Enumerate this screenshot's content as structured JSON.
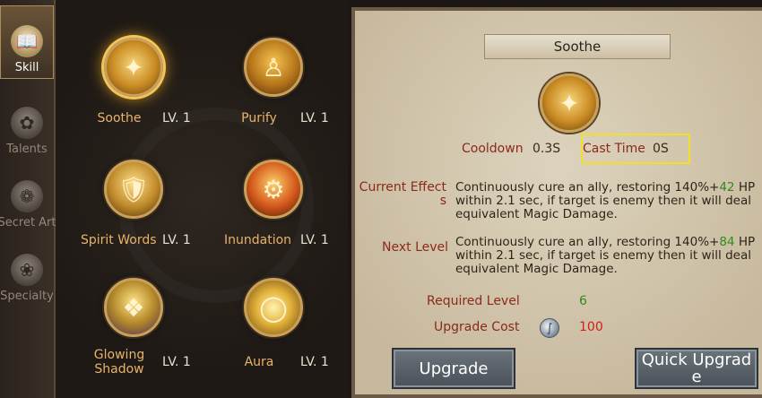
{
  "nav": {
    "items": [
      {
        "label": "Skill",
        "icon": "skill-book-icon",
        "active": true
      },
      {
        "label": "Talents",
        "icon": "talents-icon",
        "active": false
      },
      {
        "label": "Secret Art",
        "icon": "secret-art-icon",
        "active": false
      },
      {
        "label": "Specialty",
        "icon": "specialty-icon",
        "active": false
      }
    ]
  },
  "skills": [
    {
      "name": "Soothe",
      "level": "LV.  1",
      "icon": "soothe-icon"
    },
    {
      "name": "Purify",
      "level": "LV.  1",
      "icon": "purify-icon"
    },
    {
      "name": "Spirit Words",
      "level": "LV.  1",
      "icon": "spirit-words-icon"
    },
    {
      "name": "Inundation",
      "level": "LV.  1",
      "icon": "inundation-icon"
    },
    {
      "name": "Glowing Shadow",
      "level": "LV.  1",
      "icon": "glowing-shadow-icon"
    },
    {
      "name": "Aura",
      "level": "LV.  1",
      "icon": "aura-icon"
    }
  ],
  "detail": {
    "title": "Soothe",
    "cooldown_label": "Cooldown",
    "cooldown_value": "0.3S",
    "cast_time_label": "Cast Time",
    "cast_time_value": "0S",
    "current_effects_label": "Current Effects",
    "current_effects_pre": "Continuously cure an ally, restoring 140%+",
    "current_effects_num": "42",
    "current_effects_post": " HP within 2.1 sec, if target is enemy then it will deal equivalent Magic Damage.",
    "next_level_label": "Next Level",
    "next_level_pre": "Continuously cure an ally, restoring 140%+",
    "next_level_num": "84",
    "next_level_post": " HP within 2.1 sec, if target is enemy then it will deal equivalent Magic Damage.",
    "required_level_label": "Required Level",
    "required_level_value": "6",
    "upgrade_cost_label": "Upgrade Cost",
    "upgrade_cost_value": "100",
    "upgrade_cost_icon": "silver-coin-icon"
  },
  "buttons": {
    "upgrade": "Upgrade",
    "quick_upgrade": "Quick Upgrade"
  },
  "colors": {
    "label_red": "#8a2a1c",
    "green_value": "#2f8a1c",
    "cost_red": "#d51e14",
    "highlight_box": "#f1e02a"
  }
}
